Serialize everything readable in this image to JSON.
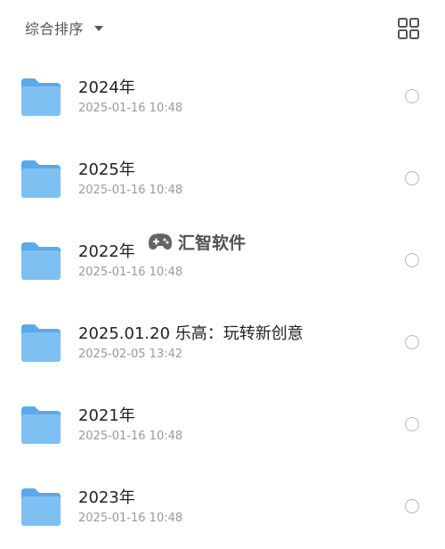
{
  "toolbar": {
    "sort_label": "综合排序",
    "sort_caret_icon": "caret-down-icon",
    "view_toggle_icon": "grid-view-icon"
  },
  "watermark": {
    "text": "汇智软件",
    "icon": "gamepad-icon"
  },
  "colors": {
    "folder_body": "#7ec0f2",
    "folder_back": "#5aa9ea",
    "title_text": "#222222",
    "meta_text": "#9a9a9a"
  },
  "files": [
    {
      "name": "2024年",
      "date": "2025-01-16 10:48",
      "selected": false,
      "icon": "folder-icon"
    },
    {
      "name": "2025年",
      "date": "2025-01-16 10:48",
      "selected": false,
      "icon": "folder-icon"
    },
    {
      "name": "2022年",
      "date": "2025-01-16 10:48",
      "selected": false,
      "icon": "folder-icon"
    },
    {
      "name": "2025.01.20 乐高：玩转新创意",
      "date": "2025-02-05 13:42",
      "selected": false,
      "icon": "folder-icon"
    },
    {
      "name": "2021年",
      "date": "2025-01-16 10:48",
      "selected": false,
      "icon": "folder-icon"
    },
    {
      "name": "2023年",
      "date": "2025-01-16 10:48",
      "selected": false,
      "icon": "folder-icon"
    }
  ]
}
